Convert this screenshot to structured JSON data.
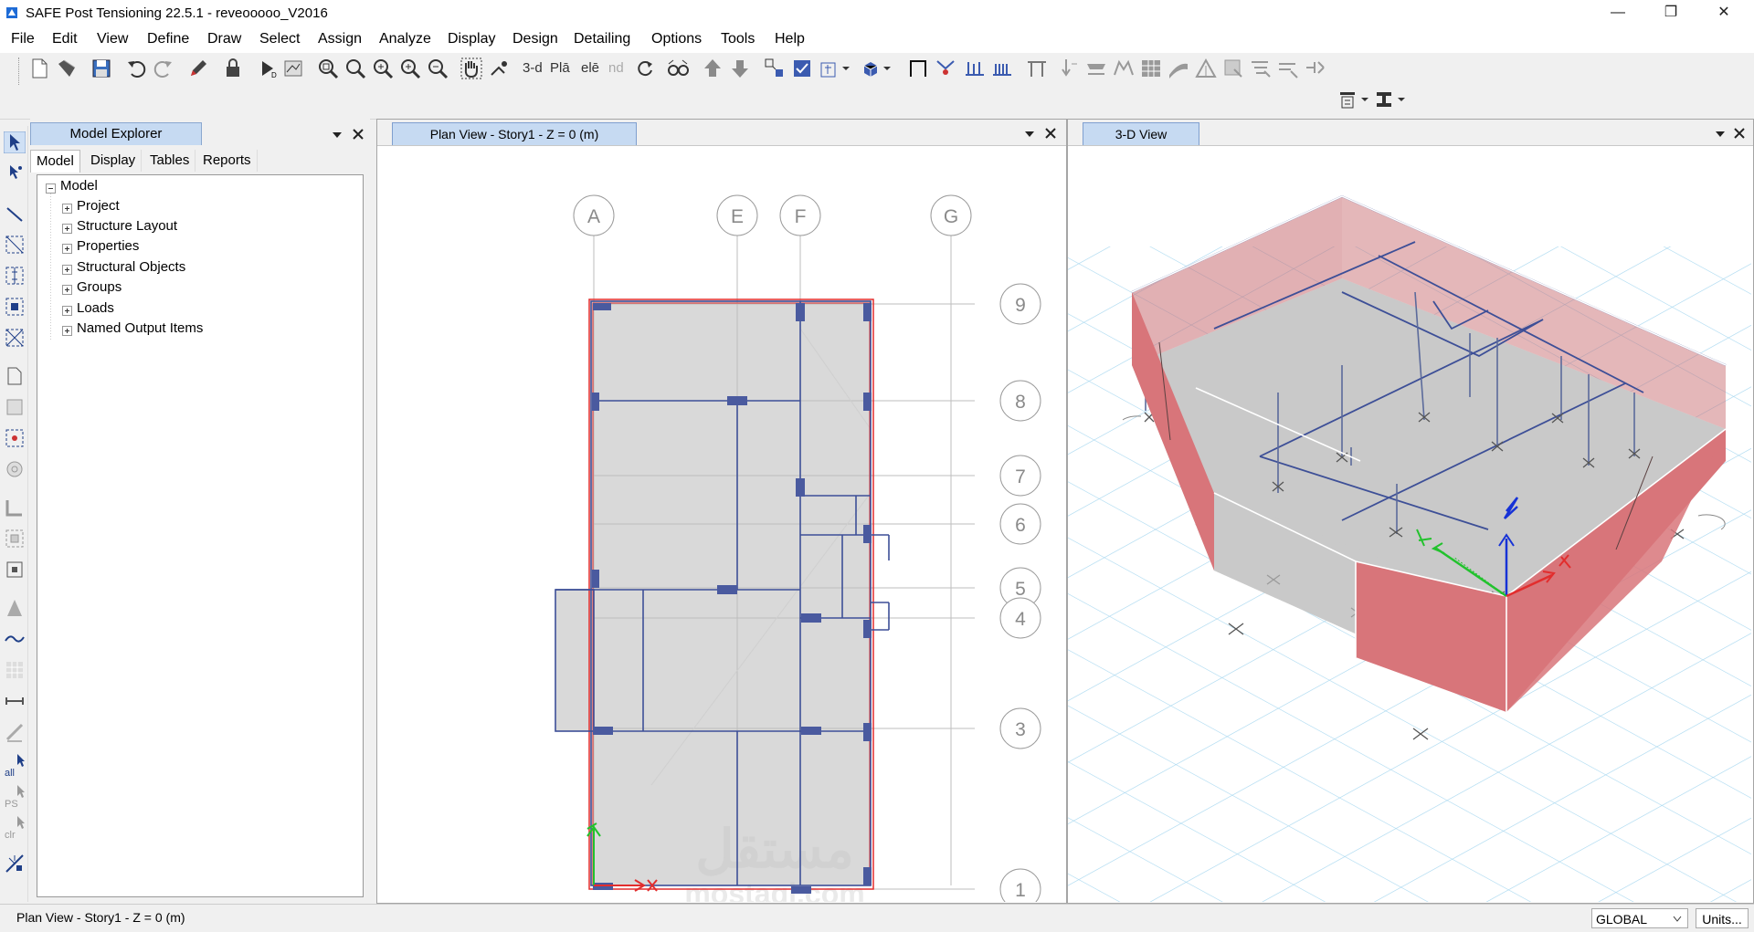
{
  "window": {
    "title": "SAFE Post Tensioning 22.5.1 - reveooooo_V2016",
    "minimize": "—",
    "restore": "❐",
    "close": "✕"
  },
  "menu": [
    "File",
    "Edit",
    "View",
    "Define",
    "Draw",
    "Select",
    "Assign",
    "Analyze",
    "Display",
    "Design",
    "Detailing",
    "Options",
    "Tools",
    "Help"
  ],
  "toolbar": {
    "view_3d": "3-d",
    "view_plan": "Plā",
    "view_elev": "elē",
    "view_nd": "nd"
  },
  "explorer": {
    "title": "Model Explorer",
    "tabs": [
      "Model",
      "Display",
      "Tables",
      "Reports"
    ],
    "active_tab": "Model",
    "root": "Model",
    "items": [
      "Project",
      "Structure Layout",
      "Properties",
      "Structural Objects",
      "Groups",
      "Loads",
      "Named Output Items"
    ]
  },
  "plan_view": {
    "tab_label": "Plan View - Story1 - Z = 0 (m)",
    "grid_x": [
      "A",
      "E",
      "F",
      "G"
    ],
    "grid_y": [
      "9",
      "8",
      "7",
      "6",
      "5",
      "4",
      "3",
      "1"
    ]
  },
  "view3d": {
    "tab_label": "3-D View"
  },
  "watermark": {
    "arabic": "مستقل",
    "latin": "mostaql.com"
  },
  "status": {
    "text": "Plan View - Story1 - Z = 0 (m)",
    "coord_system": "GLOBAL",
    "units_button": "Units..."
  },
  "colors": {
    "slab": "#d9d9d9",
    "beam": "#3d4f97",
    "column": "#4a5a9f",
    "wall": "#d8757a",
    "edge": "#e22d2d",
    "grid_bubble": "#9a9a9a",
    "floor_grid": "#a8d8f0"
  },
  "icons": {
    "panel_menu": "chevron-down-icon",
    "panel_close": "close-icon"
  }
}
